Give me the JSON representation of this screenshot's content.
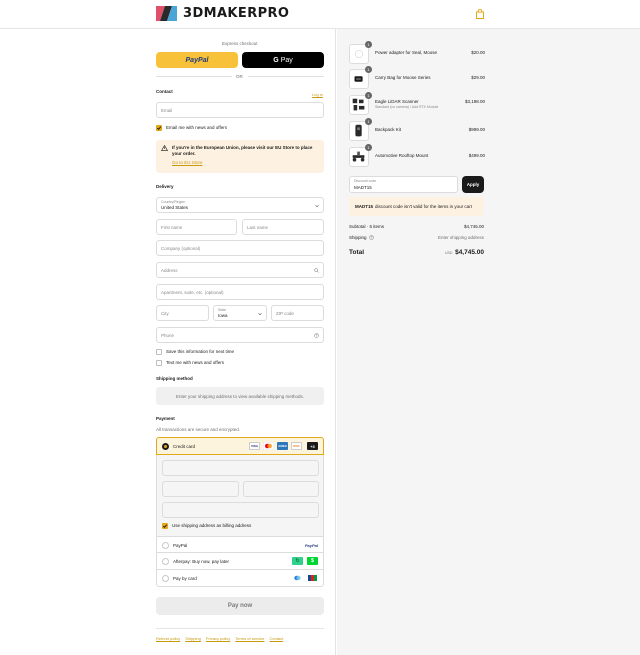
{
  "brand": {
    "name": "3DMAKERPRO",
    "accent": "#e3a81a"
  },
  "checkout": {
    "express": {
      "label": "Express checkout",
      "paypal": "PayPal",
      "gpay": "Pay",
      "or": "OR"
    },
    "contact": {
      "title": "Contact",
      "login": "Log in",
      "email_placeholder": "Email",
      "email_news": "Email me with news and offers"
    },
    "eu_notice": {
      "text": "If you're in the European Union, please visit our EU Store to place your order.",
      "link": "Go to EU Store"
    },
    "delivery": {
      "title": "Delivery",
      "country_label": "Country/Region",
      "country_value": "United States",
      "first_name": "First name",
      "last_name": "Last name",
      "company": "Company (optional)",
      "address": "Address",
      "apartment": "Apartment, suite, etc. (optional)",
      "city": "City",
      "state_label": "State",
      "state_value": "Iowa",
      "zip": "ZIP code",
      "phone": "Phone",
      "save_info": "Save this information for next time",
      "text_news": "Text me with news and offers"
    },
    "shipping_method": {
      "title": "Shipping method",
      "message": "Enter your shipping address to view available shipping methods."
    },
    "payment": {
      "title": "Payment",
      "subtitle": "All transactions are secure and encrypted.",
      "credit_card": "Credit card",
      "more_cards": "+3",
      "billing_same": "Use shipping address as billing address",
      "paypal": "PayPal",
      "paypal_logo": "PayPal",
      "afterpay": "Afterpay: Buy now, pay later",
      "pay_by_card": "Pay by card",
      "pay_now": "Pay now"
    },
    "footer_links": [
      "Refund policy",
      "Shipping",
      "Privacy policy",
      "Terms of service",
      "Contact"
    ]
  },
  "summary": {
    "items": [
      {
        "name": "Power adapter for Seal, Moose",
        "sub": "",
        "qty": "1",
        "price": "$20.00"
      },
      {
        "name": "Carry Bag for Moose Series",
        "sub": "",
        "qty": "1",
        "price": "$29.00"
      },
      {
        "name": "Eagle LiDAR Scanner",
        "sub": "Standard (no camera) / Add RTK Module",
        "qty": "1",
        "price": "$3,198.00"
      },
      {
        "name": "Backpack Kit",
        "sub": "",
        "qty": "1",
        "price": "$999.00"
      },
      {
        "name": "Automotive Rooftop Mount",
        "sub": "",
        "qty": "1",
        "price": "$499.00"
      }
    ],
    "discount": {
      "label": "Discount code",
      "value": "MADT15",
      "apply": "Apply",
      "error_code": "MADT15",
      "error_text": "discount code isn't valid for the items in your cart"
    },
    "subtotal_label": "Subtotal · 5 items",
    "subtotal_value": "$4,745.00",
    "shipping_label": "Shipping",
    "shipping_value": "Enter shipping address",
    "total_label": "Total",
    "currency": "USD",
    "total_value": "$4,745.00"
  }
}
